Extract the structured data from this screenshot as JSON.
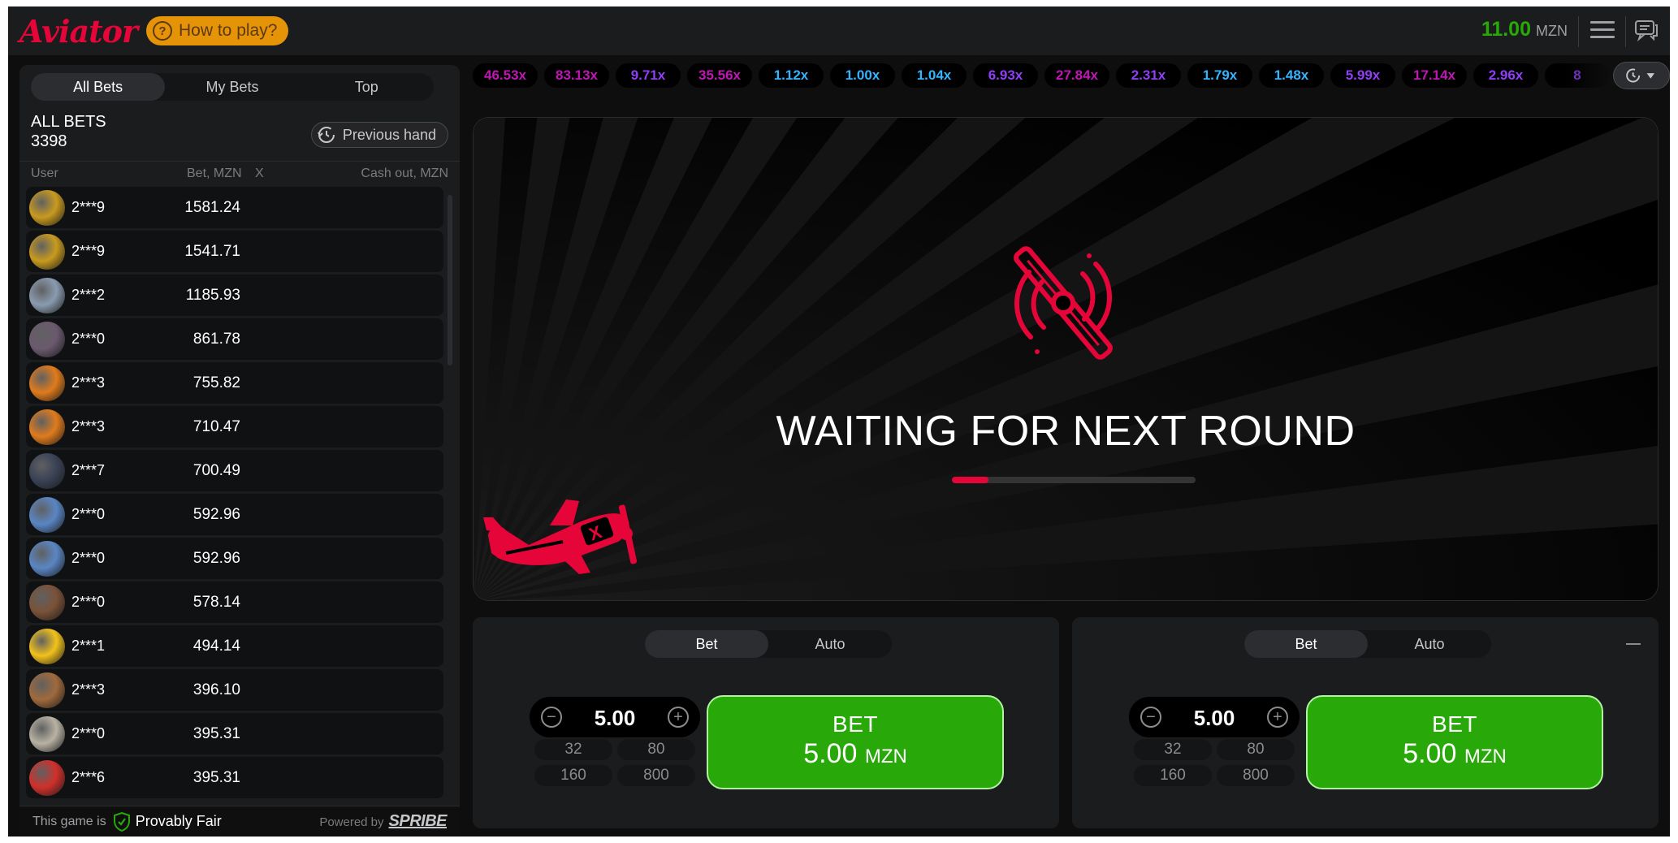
{
  "header": {
    "logo": "Aviator",
    "how_to_play": "How to play?",
    "balance": "11.00",
    "currency": "MZN"
  },
  "bets_panel": {
    "tabs": [
      {
        "label": "All Bets",
        "active": true
      },
      {
        "label": "My Bets",
        "active": false
      },
      {
        "label": "Top",
        "active": false
      }
    ],
    "title": "ALL BETS",
    "count": "3398",
    "previous_hand": "Previous hand",
    "columns": {
      "user": "User",
      "bet": "Bet, MZN",
      "x": "X",
      "cashout": "Cash out, MZN"
    },
    "rows": [
      {
        "user": "2***9",
        "bet": "1581.24",
        "avatar_color": "#c89a1e"
      },
      {
        "user": "2***9",
        "bet": "1541.71",
        "avatar_color": "#c89a1e"
      },
      {
        "user": "2***2",
        "bet": "1185.93",
        "avatar_color": "#8a9bb0"
      },
      {
        "user": "2***0",
        "bet": "861.78",
        "avatar_color": "#6b5a6e"
      },
      {
        "user": "2***3",
        "bet": "755.82",
        "avatar_color": "#e07b1c"
      },
      {
        "user": "2***3",
        "bet": "710.47",
        "avatar_color": "#e07b1c"
      },
      {
        "user": "2***7",
        "bet": "700.49",
        "avatar_color": "#3a4256"
      },
      {
        "user": "2***0",
        "bet": "592.96",
        "avatar_color": "#5a86c4"
      },
      {
        "user": "2***0",
        "bet": "592.96",
        "avatar_color": "#5a86c4"
      },
      {
        "user": "2***0",
        "bet": "578.14",
        "avatar_color": "#7a5238"
      },
      {
        "user": "2***1",
        "bet": "494.14",
        "avatar_color": "#f2c21b"
      },
      {
        "user": "2***3",
        "bet": "396.10",
        "avatar_color": "#a06a3c"
      },
      {
        "user": "2***0",
        "bet": "395.31",
        "avatar_color": "#b8b2a3"
      },
      {
        "user": "2***6",
        "bet": "395.31",
        "avatar_color": "#d0302a"
      }
    ],
    "footer": {
      "this_game_is": "This game is",
      "provably_fair": "Provably Fair",
      "powered_by": "Powered by",
      "brand": "SPRIBE"
    }
  },
  "history": [
    {
      "value": "46.53x",
      "color": "#c017b4"
    },
    {
      "value": "83.13x",
      "color": "#c017b4"
    },
    {
      "value": "9.71x",
      "color": "#913ef8"
    },
    {
      "value": "35.56x",
      "color": "#c017b4"
    },
    {
      "value": "1.12x",
      "color": "#34b4ff"
    },
    {
      "value": "1.00x",
      "color": "#34b4ff"
    },
    {
      "value": "1.04x",
      "color": "#34b4ff"
    },
    {
      "value": "6.93x",
      "color": "#913ef8"
    },
    {
      "value": "27.84x",
      "color": "#c017b4"
    },
    {
      "value": "2.31x",
      "color": "#913ef8"
    },
    {
      "value": "1.79x",
      "color": "#34b4ff"
    },
    {
      "value": "1.48x",
      "color": "#34b4ff"
    },
    {
      "value": "5.99x",
      "color": "#913ef8"
    },
    {
      "value": "17.14x",
      "color": "#c017b4"
    },
    {
      "value": "2.96x",
      "color": "#913ef8"
    },
    {
      "value": "8",
      "color": "#913ef8"
    }
  ],
  "game": {
    "status": "WAITING FOR NEXT ROUND",
    "progress": 0.15
  },
  "bet_panels": [
    {
      "tabs": [
        {
          "label": "Bet",
          "active": true
        },
        {
          "label": "Auto",
          "active": false
        }
      ],
      "amount": "5.00",
      "quick": [
        "32",
        "80",
        "160",
        "800"
      ],
      "button_label": "BET",
      "button_amount": "5.00",
      "button_currency": "MZN"
    },
    {
      "tabs": [
        {
          "label": "Bet",
          "active": true
        },
        {
          "label": "Auto",
          "active": false
        }
      ],
      "amount": "5.00",
      "quick": [
        "32",
        "80",
        "160",
        "800"
      ],
      "button_label": "BET",
      "button_amount": "5.00",
      "button_currency": "MZN"
    }
  ],
  "colors": {
    "brand_red": "#e50539",
    "bet_green": "#28a909",
    "how_to_orange": "#e59407"
  }
}
